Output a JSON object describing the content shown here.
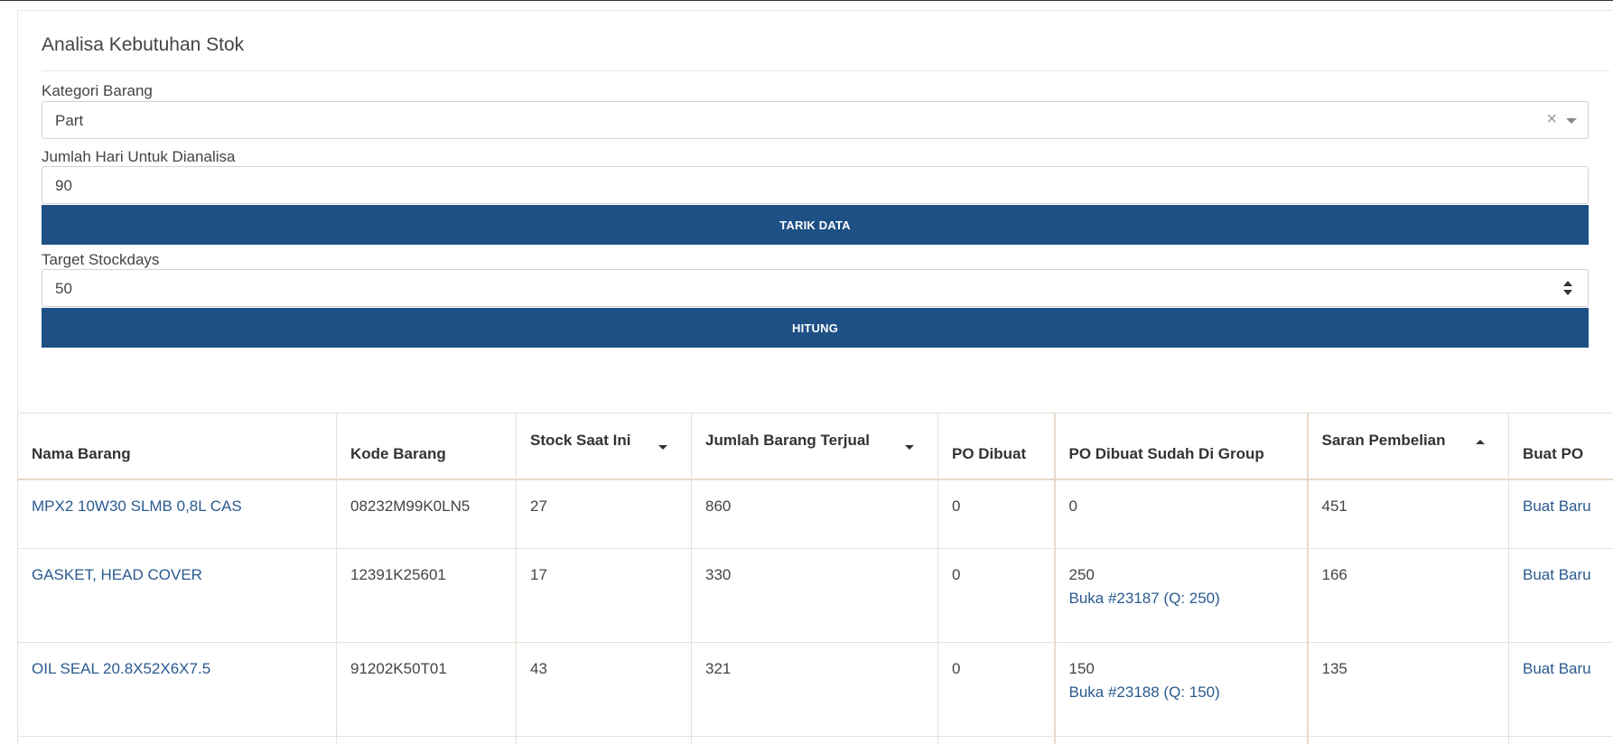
{
  "panel": {
    "title": "Analisa Kebutuhan Stok",
    "kategori_label": "Kategori Barang",
    "kategori_value": "Part",
    "clear_glyph": "×",
    "hari_label": "Jumlah Hari Untuk Dianalisa",
    "hari_value": "90",
    "tarik_button": "TARIK DATA",
    "stockdays_label": "Target Stockdays",
    "stockdays_value": "50",
    "hitung_button": "HITUNG"
  },
  "table": {
    "headers": [
      "Nama Barang",
      "Kode Barang",
      "Stock Saat Ini",
      "Jumlah Barang Terjual",
      "PO Dibuat",
      "PO Dibuat Sudah Di Group",
      "Saran Pembelian",
      "Buat PO"
    ],
    "sort": {
      "stock_saat_ini": "descending",
      "jumlah_barang_terjual": "descending",
      "saran_pembelian": "ascending"
    },
    "rows": [
      {
        "nama": "MPX2 10W30 SLMB 0,8L CAS",
        "kode": "08232M99K0LN5",
        "stock": "27",
        "terjual": "860",
        "po_dibuat": "0",
        "po_group": "0",
        "po_group_link": "",
        "saran": "451",
        "buat": "Buat Baru"
      },
      {
        "nama": "GASKET, HEAD COVER",
        "kode": "12391K25601",
        "stock": "17",
        "terjual": "330",
        "po_dibuat": "0",
        "po_group": "250",
        "po_group_link": "Buka #23187 (Q: 250)",
        "saran": "166",
        "buat": "Buat Baru"
      },
      {
        "nama": "OIL SEAL 20.8X52X6X7.5",
        "kode": "91202K50T01",
        "stock": "43",
        "terjual": "321",
        "po_dibuat": "0",
        "po_group": "150",
        "po_group_link": "Buka #23188 (Q: 150)",
        "saran": "135",
        "buat": "Buat Baru"
      }
    ]
  },
  "colors": {
    "button_bg": "#1e5085",
    "link": "#2a5a8f",
    "table_border": "#e7e1d9"
  }
}
